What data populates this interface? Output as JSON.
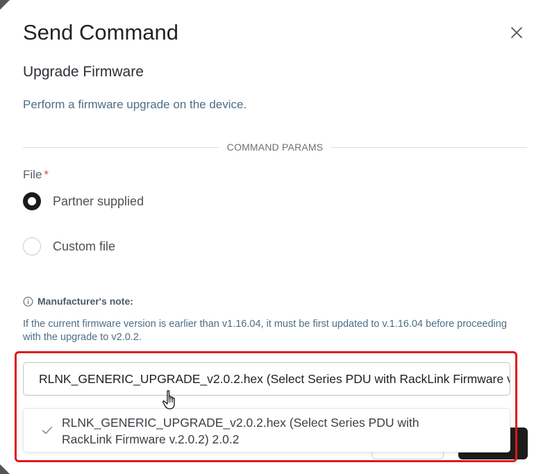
{
  "dialog": {
    "title": "Send Command",
    "close_icon": "close-icon"
  },
  "command": {
    "name": "Upgrade Firmware",
    "description": "Perform a firmware upgrade on the device."
  },
  "params": {
    "divider_label": "COMMAND PARAMS",
    "file_label": "File",
    "required_marker": "*",
    "options": [
      {
        "label": "Partner supplied",
        "selected": true
      },
      {
        "label": "Custom file",
        "selected": false
      }
    ]
  },
  "note": {
    "icon": "info-icon",
    "heading": "Manufacturer's note:",
    "body": "If the current firmware version is earlier than v1.16.04, it must be first updated to v.1.16.04 before proceeding with the upgrade to v2.0.2."
  },
  "firmware_select": {
    "value": "RLNK_GENERIC_UPGRADE_v2.0.2.hex (Select Series PDU with RackLink Firmware v.2.0.2) 2.0.2",
    "options": [
      {
        "label": "RLNK_GENERIC_UPGRADE_v2.0.2.hex (Select Series PDU with RackLink Firmware v.2.0.2) 2.0.2",
        "selected": true,
        "icon": "check-icon"
      }
    ]
  },
  "colors": {
    "highlight": "#e2161b",
    "required": "#e04848",
    "description": "#4a6e85"
  }
}
